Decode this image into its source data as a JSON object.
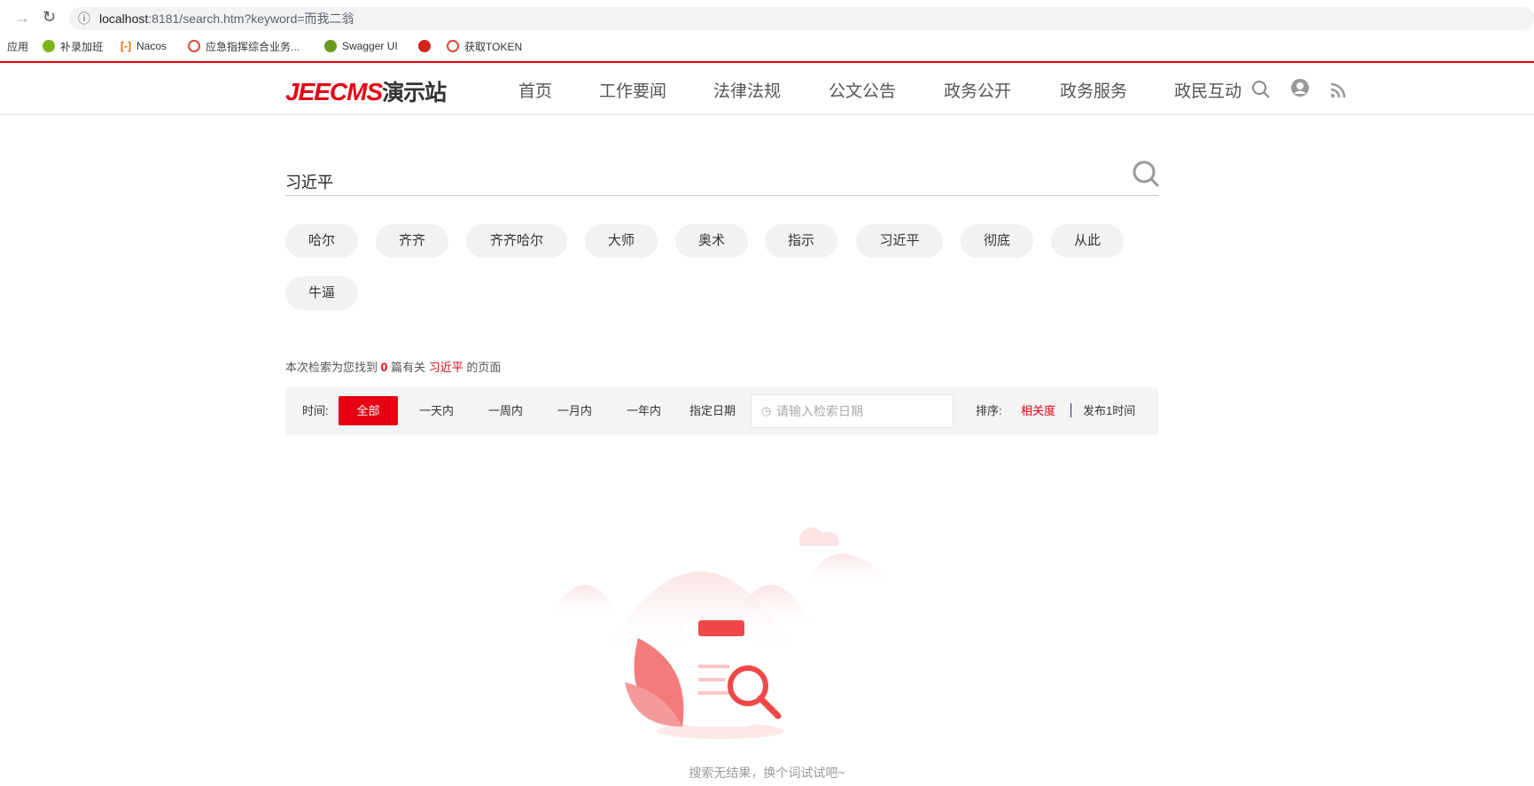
{
  "browser": {
    "url_host": "localhost",
    "url_rest": ":8181/search.htm?keyword=而我二翁",
    "bookmarks": [
      "应用",
      "补录加班",
      "Nacos",
      "应急指挥综合业务...",
      "Swagger UI",
      "",
      "获取TOKEN"
    ]
  },
  "header": {
    "logo_text": "JEECMS",
    "logo_sub": "演示站",
    "nav": [
      "首页",
      "工作要闻",
      "法律法规",
      "公文公告",
      "政务公开",
      "政务服务",
      "政民互动"
    ]
  },
  "search": {
    "value": "习近平"
  },
  "tags": [
    "哈尔",
    "齐齐",
    "齐齐哈尔",
    "大师",
    "奥术",
    "指示",
    "习近平",
    "彻底",
    "从此",
    "牛逼"
  ],
  "result": {
    "prefix": "本次检索为您找到",
    "count": "0",
    "middle": "篇有关",
    "keyword": "习近平",
    "suffix": "的页面"
  },
  "filter": {
    "time_label": "时间:",
    "options": [
      "全部",
      "一天内",
      "一周内",
      "一月内",
      "一年内",
      "指定日期"
    ],
    "date_placeholder": "请输入检索日期",
    "sort_label": "排序:",
    "sort_relevance": "相关度",
    "sort_time": "发布1时间"
  },
  "empty": {
    "message": "搜索无结果，换个词试试吧~"
  },
  "colors": {
    "accent": "#e60012"
  }
}
